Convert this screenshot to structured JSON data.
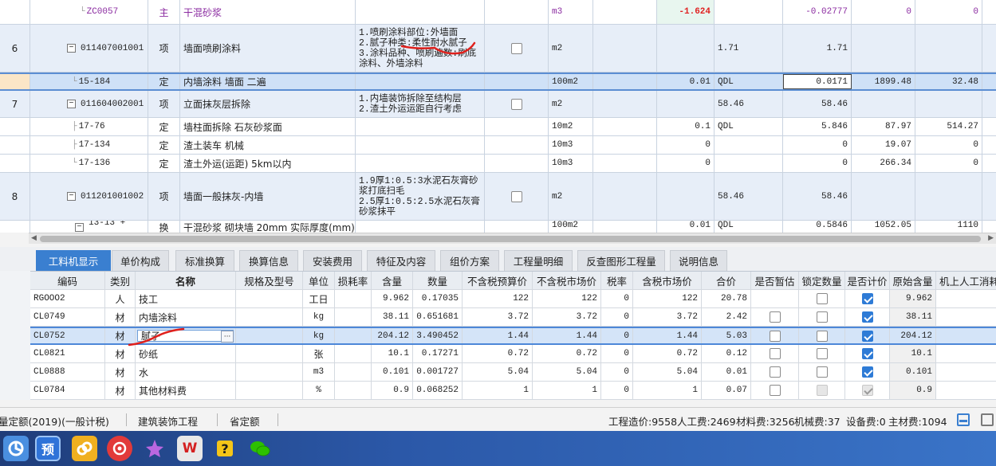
{
  "upper_grid": {
    "rows": [
      {
        "seq": "",
        "code": "ZC0057",
        "type": "主",
        "name": "干混砂浆",
        "feature": "",
        "unit": "m3",
        "qty_expr": "-1.624",
        "qty_code": "",
        "qty": "-0.02777",
        "price": "0",
        "total": "0",
        "kind": "zc"
      },
      {
        "seq": "6",
        "code": "011407001001",
        "type": "项",
        "name": "墙面喷刷涂料",
        "feature": "1.喷刷涂料部位:外墙面\n2.腻子种类:柔性耐水腻子\n3.涂料品种、喷刷遍数:刷底涂料、外墙涂料",
        "unit": "m2",
        "qty_expr": "",
        "qty_code": "1.71",
        "qty": "1.71",
        "price": "",
        "total": "",
        "kind": "qd"
      },
      {
        "seq": "",
        "code": "15-184",
        "type": "定",
        "name": "内墙涂料 墙面 二遍",
        "feature": "",
        "unit": "100m2",
        "qty_expr": "0.01",
        "qty_code": "QDL",
        "qty": "0.0171",
        "price": "1899.48",
        "total": "32.48",
        "kind": "sel"
      },
      {
        "seq": "7",
        "code": "011604002001",
        "type": "项",
        "name": "立面抹灰层拆除",
        "feature": "1.内墙装饰拆除至结构层\n2.渣土外运运距自行考虑",
        "unit": "m2",
        "qty_expr": "",
        "qty_code": "58.46",
        "qty": "58.46",
        "price": "",
        "total": "",
        "kind": "qd"
      },
      {
        "seq": "",
        "code": "17-76",
        "type": "定",
        "name": "墙柱面拆除 石灰砂浆面",
        "feature": "",
        "unit": "10m2",
        "qty_expr": "0.1",
        "qty_code": "QDL",
        "qty": "5.846",
        "price": "87.97",
        "total": "514.27",
        "kind": "de"
      },
      {
        "seq": "",
        "code": "17-134",
        "type": "定",
        "name": "渣土装车 机械",
        "feature": "",
        "unit": "10m3",
        "qty_expr": "0",
        "qty_code": "",
        "qty": "0",
        "price": "19.07",
        "total": "0",
        "kind": "de"
      },
      {
        "seq": "",
        "code": "17-136",
        "type": "定",
        "name": "渣土外运(运距) 5km以内",
        "feature": "",
        "unit": "10m3",
        "qty_expr": "0",
        "qty_code": "",
        "qty": "0",
        "price": "266.34",
        "total": "0",
        "kind": "de"
      },
      {
        "seq": "8",
        "code": "011201001002",
        "type": "项",
        "name": "墙面一般抹灰-内墙",
        "feature": "1.9厚1:0.5:3水泥石灰膏砂浆打底扫毛\n2.5厚1:0.5:2.5水泥石灰膏砂浆抹平",
        "unit": "m2",
        "qty_expr": "",
        "qty_code": "58.46",
        "qty": "58.46",
        "price": "",
        "total": "",
        "kind": "qd"
      },
      {
        "seq": "",
        "code": "13-13 +",
        "type": "换",
        "name": "干混砂浆 砌块墙 20mm 实际厚度(mm):",
        "feature": "",
        "unit": "100m2",
        "qty_expr": "0.01",
        "qty_code": "QDL",
        "qty": "0.5846",
        "price": "1052.05",
        "total": "1110",
        "kind": "de"
      }
    ]
  },
  "tabs": [
    {
      "label": "工料机显示",
      "active": true
    },
    {
      "label": "单价构成"
    },
    {
      "label": "标准换算"
    },
    {
      "label": "换算信息"
    },
    {
      "label": "安装费用"
    },
    {
      "label": "特征及内容"
    },
    {
      "label": "组价方案"
    },
    {
      "label": "工程量明细"
    },
    {
      "label": "反查图形工程量"
    },
    {
      "label": "说明信息"
    }
  ],
  "lower_grid": {
    "headers": [
      "编码",
      "类别",
      "名称",
      "规格及型号",
      "单位",
      "损耗率",
      "含量",
      "数量",
      "不含税预算价",
      "不含税市场价",
      "税率",
      "含税市场价",
      "合价",
      "是否暂估",
      "锁定数量",
      "是否计价",
      "原始含量",
      "机上人工消耗"
    ],
    "rows": [
      {
        "num": "2",
        "code": "RGOOO2",
        "cat": "人",
        "name": "技工",
        "spec": "",
        "unit": "工日",
        "loss": "",
        "content": "9.962",
        "qty": "0.17035",
        "pre_budget": "122",
        "pre_market": "122",
        "tax": "0",
        "post_market": "122",
        "total": "20.78",
        "est": "none",
        "lock": "off",
        "priced": "on",
        "orig": "9.962"
      },
      {
        "num": "3",
        "code": "CL0749",
        "cat": "材",
        "name": "内墙涂料",
        "spec": "",
        "unit": "kg",
        "loss": "",
        "content": "38.11",
        "qty": "0.651681",
        "pre_budget": "3.72",
        "pre_market": "3.72",
        "tax": "0",
        "post_market": "3.72",
        "total": "2.42",
        "est": "off",
        "lock": "off",
        "priced": "on",
        "orig": "38.11"
      },
      {
        "num": "4",
        "code": "CL0752",
        "cat": "材",
        "name": "腻子",
        "spec": "",
        "unit": "kg",
        "loss": "",
        "content": "204.12",
        "qty": "3.490452",
        "pre_budget": "1.44",
        "pre_market": "1.44",
        "tax": "0",
        "post_market": "1.44",
        "total": "5.03",
        "est": "off",
        "lock": "off",
        "priced": "on",
        "orig": "204.12"
      },
      {
        "num": "5",
        "code": "CL0821",
        "cat": "材",
        "name": "砂纸",
        "spec": "",
        "unit": "张",
        "loss": "",
        "content": "10.1",
        "qty": "0.17271",
        "pre_budget": "0.72",
        "pre_market": "0.72",
        "tax": "0",
        "post_market": "0.72",
        "total": "0.12",
        "est": "off",
        "lock": "off",
        "priced": "on",
        "orig": "10.1"
      },
      {
        "num": "6",
        "code": "CL0888",
        "cat": "材",
        "name": "水",
        "spec": "",
        "unit": "m3",
        "loss": "",
        "content": "0.101",
        "qty": "0.001727",
        "pre_budget": "5.04",
        "pre_market": "5.04",
        "tax": "0",
        "post_market": "5.04",
        "total": "0.01",
        "est": "off",
        "lock": "off",
        "priced": "on",
        "orig": "0.101"
      },
      {
        "num": "7",
        "code": "CL0784",
        "cat": "材",
        "name": "其他材料费",
        "spec": "",
        "unit": "%",
        "loss": "",
        "content": "0.9",
        "qty": "0.068252",
        "pre_budget": "1",
        "pre_market": "1",
        "tax": "0",
        "post_market": "1",
        "total": "0.07",
        "est": "off",
        "lock": "disabled",
        "priced": "disabled",
        "orig": "0.9"
      }
    ],
    "ellipsis": "···"
  },
  "status_bar": {
    "quota": "量定额(2019)(一般计税)",
    "project_type": "建筑装饰工程",
    "province": "省定额",
    "cost": "工程造价:9558",
    "labor": "人工费:2469",
    "material": "材料费:3256",
    "machine": "机械费:37",
    "equipment": "设备费:0",
    "main_material": "主材费:1094"
  },
  "taskbar": {
    "icons": [
      "app-icon",
      "yu-icon",
      "link-icon",
      "netease-icon",
      "star-icon",
      "wps-icon",
      "question-icon",
      "wechat-icon"
    ],
    "yu_label": "预",
    "wps_label": "W"
  },
  "colors": {
    "accent": "#3a7fd0",
    "annotation": "#e0201c",
    "purple": "#8a2aa0"
  }
}
